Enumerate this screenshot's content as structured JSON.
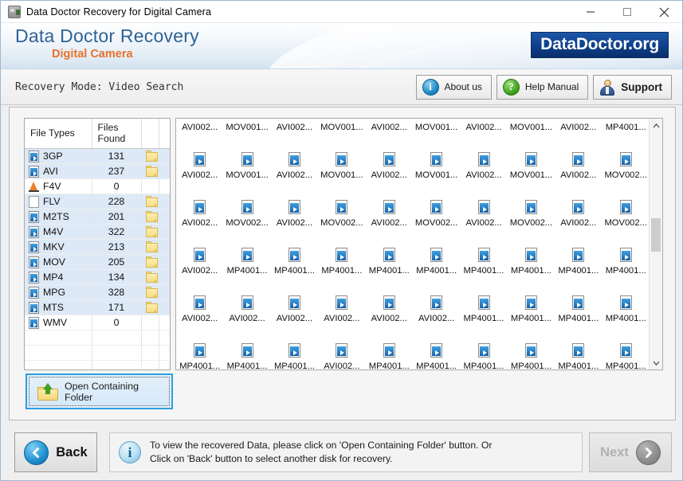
{
  "window": {
    "title": "Data Doctor Recovery for Digital Camera",
    "icon": "camera-icon",
    "controls": [
      {
        "name": "minimize-button",
        "glyph": "—"
      },
      {
        "name": "maximize-button",
        "glyph": "▢"
      },
      {
        "name": "close-button",
        "glyph": "✕"
      }
    ]
  },
  "banner": {
    "brand_main": "Data Doctor Recovery",
    "brand_sub": "Digital Camera",
    "logo": "DataDoctor.org",
    "brand_main_color": "#2e6395",
    "brand_sub_color": "#e8722a",
    "logo_bg": "#0d3d86"
  },
  "toolbar": {
    "recovery_mode": "Recovery Mode: Video Search",
    "buttons": [
      {
        "label": "About us",
        "icon": "info-icon",
        "color": "#1a87c4"
      },
      {
        "label": "Help Manual",
        "icon": "question-icon",
        "color": "#3da01c"
      },
      {
        "label": "Support",
        "icon": "support-person-icon",
        "color": "#2c4f83"
      }
    ]
  },
  "file_types": {
    "headers": [
      "File Types",
      "Files Found",
      "",
      ""
    ],
    "rows": [
      {
        "icon": "video-file-icon",
        "type": "3GP",
        "count": "131",
        "folder": true,
        "selected": true
      },
      {
        "icon": "video-file-icon",
        "type": "AVI",
        "count": "237",
        "folder": true,
        "selected": true
      },
      {
        "icon": "vlc-cone-icon",
        "type": "F4V",
        "count": "0",
        "folder": false,
        "selected": false
      },
      {
        "icon": "blank-file-icon",
        "type": "FLV",
        "count": "228",
        "folder": true,
        "selected": true
      },
      {
        "icon": "video-file-icon",
        "type": "M2TS",
        "count": "201",
        "folder": true,
        "selected": true
      },
      {
        "icon": "video-file-icon",
        "type": "M4V",
        "count": "322",
        "folder": true,
        "selected": true
      },
      {
        "icon": "video-file-icon",
        "type": "MKV",
        "count": "213",
        "folder": true,
        "selected": true
      },
      {
        "icon": "video-file-icon",
        "type": "MOV",
        "count": "205",
        "folder": true,
        "selected": true
      },
      {
        "icon": "video-file-icon",
        "type": "MP4",
        "count": "134",
        "folder": true,
        "selected": true
      },
      {
        "icon": "video-file-icon",
        "type": "MPG",
        "count": "328",
        "folder": true,
        "selected": true
      },
      {
        "icon": "video-file-icon",
        "type": "MTS",
        "count": "171",
        "folder": true,
        "selected": true
      },
      {
        "icon": "video-file-icon",
        "type": "WMV",
        "count": "0",
        "folder": false,
        "selected": false
      }
    ]
  },
  "file_grid": {
    "icon": "video-file-icon",
    "columns": 10,
    "rows": [
      [
        "AVI002...",
        "MOV001...",
        "AVI002...",
        "MOV001...",
        "AVI002...",
        "MOV001...",
        "AVI002...",
        "MOV001...",
        "AVI002...",
        "MP4001..."
      ],
      [
        "AVI002...",
        "MOV001...",
        "AVI002...",
        "MOV001...",
        "AVI002...",
        "MOV001...",
        "AVI002...",
        "MOV001...",
        "AVI002...",
        "MOV002..."
      ],
      [
        "AVI002...",
        "MOV002...",
        "AVI002...",
        "MOV002...",
        "AVI002...",
        "MOV002...",
        "AVI002...",
        "MOV002...",
        "AVI002...",
        "MOV002..."
      ],
      [
        "AVI002...",
        "MP4001...",
        "MP4001...",
        "MP4001...",
        "MP4001...",
        "MP4001...",
        "MP4001...",
        "MP4001...",
        "MP4001...",
        "MP4001..."
      ],
      [
        "AVI002...",
        "AVI002...",
        "AVI002...",
        "AVI002...",
        "AVI002...",
        "AVI002...",
        "MP4001...",
        "MP4001...",
        "MP4001...",
        "MP4001..."
      ],
      [
        "MP4001...",
        "MP4001...",
        "MP4001...",
        "AVI002...",
        "MP4001...",
        "MP4001...",
        "MP4001...",
        "MP4001...",
        "MP4001...",
        "MP4001..."
      ]
    ],
    "scroll_up_glyph": "⌃",
    "scroll_down_glyph": "⌄"
  },
  "open_folder_button": {
    "label": "Open Containing Folder",
    "icon": "open-folder-up-arrow-icon",
    "focus_color": "#2a9ee0"
  },
  "footer": {
    "back_label": "Back",
    "next_label": "Next",
    "next_disabled": true,
    "info_icon": "info-icon",
    "info_line1": "To view the recovered Data, please click on 'Open Containing Folder' button. Or",
    "info_line2": "Click on 'Back' button to select another disk for recovery."
  }
}
